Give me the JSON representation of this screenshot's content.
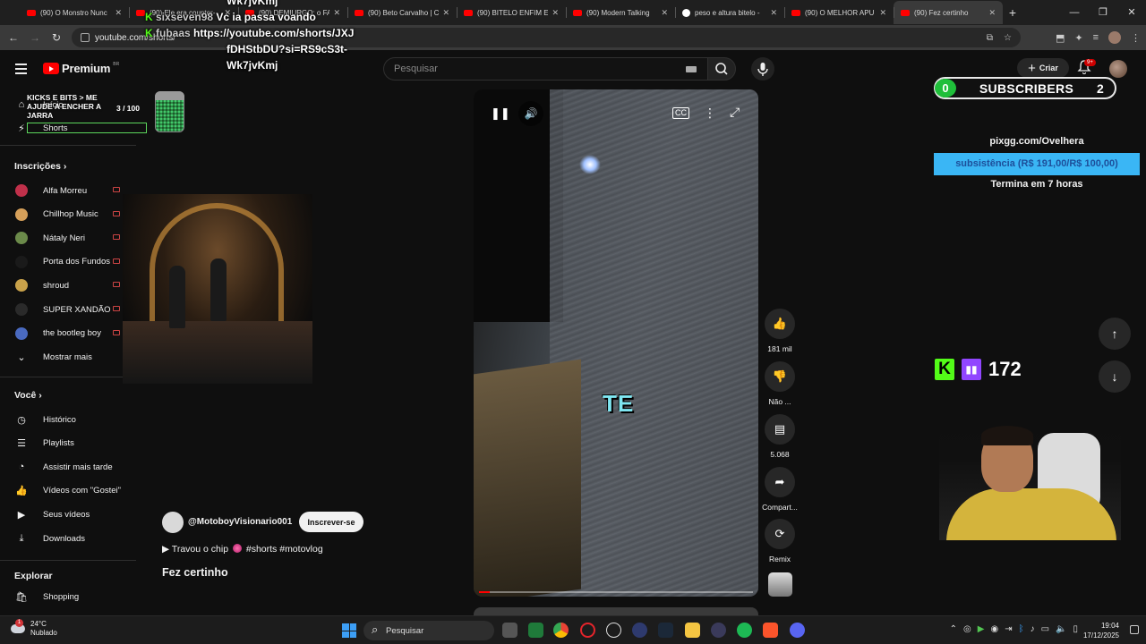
{
  "browser": {
    "tabs": [
      {
        "title": "(90) O Monstro Nunc",
        "favicon": "youtube"
      },
      {
        "title": "(90) Ele era counter-",
        "favicon": "youtube"
      },
      {
        "title": "(90) DEMIURGO: o FA",
        "favicon": "youtube"
      },
      {
        "title": "(90) Beto Carvalho | C",
        "favicon": "youtube"
      },
      {
        "title": "(90) BITELO ENFIM EN",
        "favicon": "youtube"
      },
      {
        "title": "(90) Modern Talking",
        "favicon": "youtube"
      },
      {
        "title": "peso e altura bitelo -",
        "favicon": "google"
      },
      {
        "title": "(90) O MELHOR APU",
        "favicon": "youtube"
      },
      {
        "title": "(90) Fez certinho",
        "favicon": "youtube",
        "active": true
      }
    ],
    "url": "youtube.com/shorts/JXJfDHStbDU?si=RS9cS3t-Wk7jvKmj",
    "url_visible": "youtube.com/shorts/"
  },
  "youtube": {
    "logo_text": "Premium",
    "logo_country": "BR",
    "search_placeholder": "Pesquisar",
    "create_label": "Criar",
    "notif_badge": "9+"
  },
  "sidebar": {
    "top": [
      {
        "label": "Início",
        "icon": "home-icon"
      },
      {
        "label": "Shorts",
        "icon": "shorts-icon"
      }
    ],
    "subscriptions_title": "Inscrições",
    "subscriptions": [
      {
        "label": "Alfa Morreu",
        "color": "#c0304a"
      },
      {
        "label": "Chillhop Music",
        "color": "#d6a05a"
      },
      {
        "label": "Nátaly Neri",
        "color": "#6b8a4a"
      },
      {
        "label": "Porta dos Fundos",
        "color": "#1a1a1a"
      },
      {
        "label": "shroud",
        "color": "#c9a24a"
      },
      {
        "label": "SUPER XANDÃO",
        "color": "#2a2a2a"
      },
      {
        "label": "the bootleg boy",
        "color": "#4a6ac0"
      }
    ],
    "show_more": "Mostrar mais",
    "you_title": "Você",
    "you_items": [
      {
        "label": "Histórico",
        "icon": "history-icon"
      },
      {
        "label": "Playlists",
        "icon": "playlist-icon"
      },
      {
        "label": "Assistir mais tarde",
        "icon": "clock-icon"
      },
      {
        "label": "Vídeos com \"Gostei\"",
        "icon": "thumbs-up-icon"
      },
      {
        "label": "Seus vídeos",
        "icon": "video-icon"
      },
      {
        "label": "Downloads",
        "icon": "download-icon"
      }
    ],
    "explore_title": "Explorar",
    "explore_items": [
      {
        "label": "Shopping",
        "icon": "shopping-bag-icon"
      }
    ]
  },
  "stream_overlay": {
    "chat": [
      {
        "user": "",
        "message": "Wk7jvKmj"
      },
      {
        "user": "sixseven98",
        "message": "Vc ia passa voando"
      },
      {
        "user": "fubaas",
        "message": "https://youtube.com/shorts/JXJ"
      },
      {
        "user": "",
        "message": "fDHStbDU?si=RS9cS3t-"
      },
      {
        "user": "",
        "message": "Wk7jvKmj"
      }
    ],
    "kicks_goal_title": "KICKS E BITS > ME AJUDE A ENCHER A JARRA",
    "kicks_goal_count": "3  / 100",
    "subscribers_left": "0",
    "subscribers_label": "SUBSCRIBERS",
    "subscribers_right": "2",
    "pix_link": "pixgg.com/Ovelhera",
    "goal_text": "subsistência (R$ 191,00/R$ 100,00)",
    "goal_ends": "Termina em 7 horas",
    "viewers": "172"
  },
  "short": {
    "caption_overlay": "TE",
    "progress": 0.04,
    "channel": "@MotoboyVisionario001",
    "subscribe_label": "Inscrever-se",
    "description_prefix": "▶ Travou o chip",
    "hashtags": "#shorts #motovlog",
    "title": "Fez certinho",
    "actions": [
      {
        "label": "181 mil",
        "icon": "thumbs-up-icon"
      },
      {
        "label": "Não ...",
        "icon": "thumbs-down-icon"
      },
      {
        "label": "5.068",
        "icon": "comment-icon"
      },
      {
        "label": "Compart...",
        "icon": "share-icon"
      },
      {
        "label": "Remix",
        "icon": "remix-icon"
      }
    ]
  },
  "taskbar": {
    "temperature": "24°C",
    "weather": "Nublado",
    "search_placeholder": "Pesquisar",
    "time": "19:04",
    "date": "17/12/2025"
  }
}
